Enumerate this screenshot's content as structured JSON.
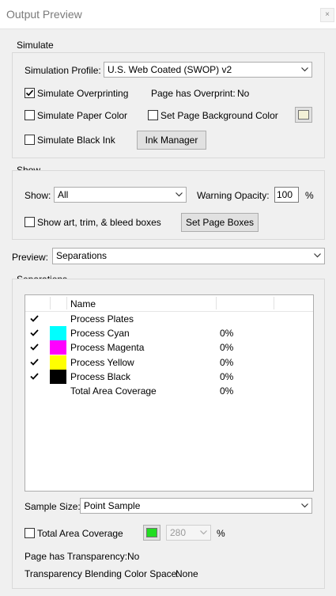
{
  "window": {
    "title": "Output Preview",
    "close_label": "×"
  },
  "simulate": {
    "label": "Simulate",
    "profile_label": "Simulation Profile:",
    "profile_value": "U.S. Web Coated (SWOP) v2",
    "overprinting_label": "Simulate Overprinting",
    "overprinting_checked": true,
    "page_overprint_label": "Page has Overprint:",
    "page_overprint_value": "No",
    "paper_color_label": "Simulate Paper Color",
    "bg_color_label": "Set Page Background Color",
    "bg_color": "#f3f0d7",
    "black_ink_label": "Simulate Black Ink",
    "ink_manager_label": "Ink Manager"
  },
  "show": {
    "label": "Show",
    "show_label": "Show:",
    "show_value": "All",
    "opacity_label": "Warning Opacity:",
    "opacity_value": "100",
    "opacity_unit": "%",
    "boxes_label": "Show art, trim, & bleed boxes",
    "page_boxes_label": "Set Page Boxes"
  },
  "preview": {
    "label": "Preview:",
    "value": "Separations"
  },
  "separations": {
    "label": "Separations",
    "col_name": "Name",
    "rows": [
      {
        "name": "Process Plates",
        "checked": true,
        "color": "",
        "percent": ""
      },
      {
        "name": "Process Cyan",
        "checked": true,
        "color": "#00ffff",
        "percent": "0%"
      },
      {
        "name": "Process Magenta",
        "checked": true,
        "color": "#ff00ff",
        "percent": "0%"
      },
      {
        "name": "Process Yellow",
        "checked": true,
        "color": "#ffff00",
        "percent": "0%"
      },
      {
        "name": "Process Black",
        "checked": true,
        "color": "#000000",
        "percent": "0%"
      },
      {
        "name": "Total Area Coverage",
        "checked": false,
        "color": "",
        "percent": "0%"
      }
    ],
    "sample_size_label": "Sample Size:",
    "sample_size_value": "Point Sample",
    "tac_label": "Total Area Coverage",
    "tac_color": "#22dd22",
    "tac_value": "280",
    "tac_unit": "%",
    "transparency_label": "Page has Transparency:",
    "transparency_value": "No",
    "blend_label": "Transparency Blending Color Space:",
    "blend_value": "None"
  }
}
